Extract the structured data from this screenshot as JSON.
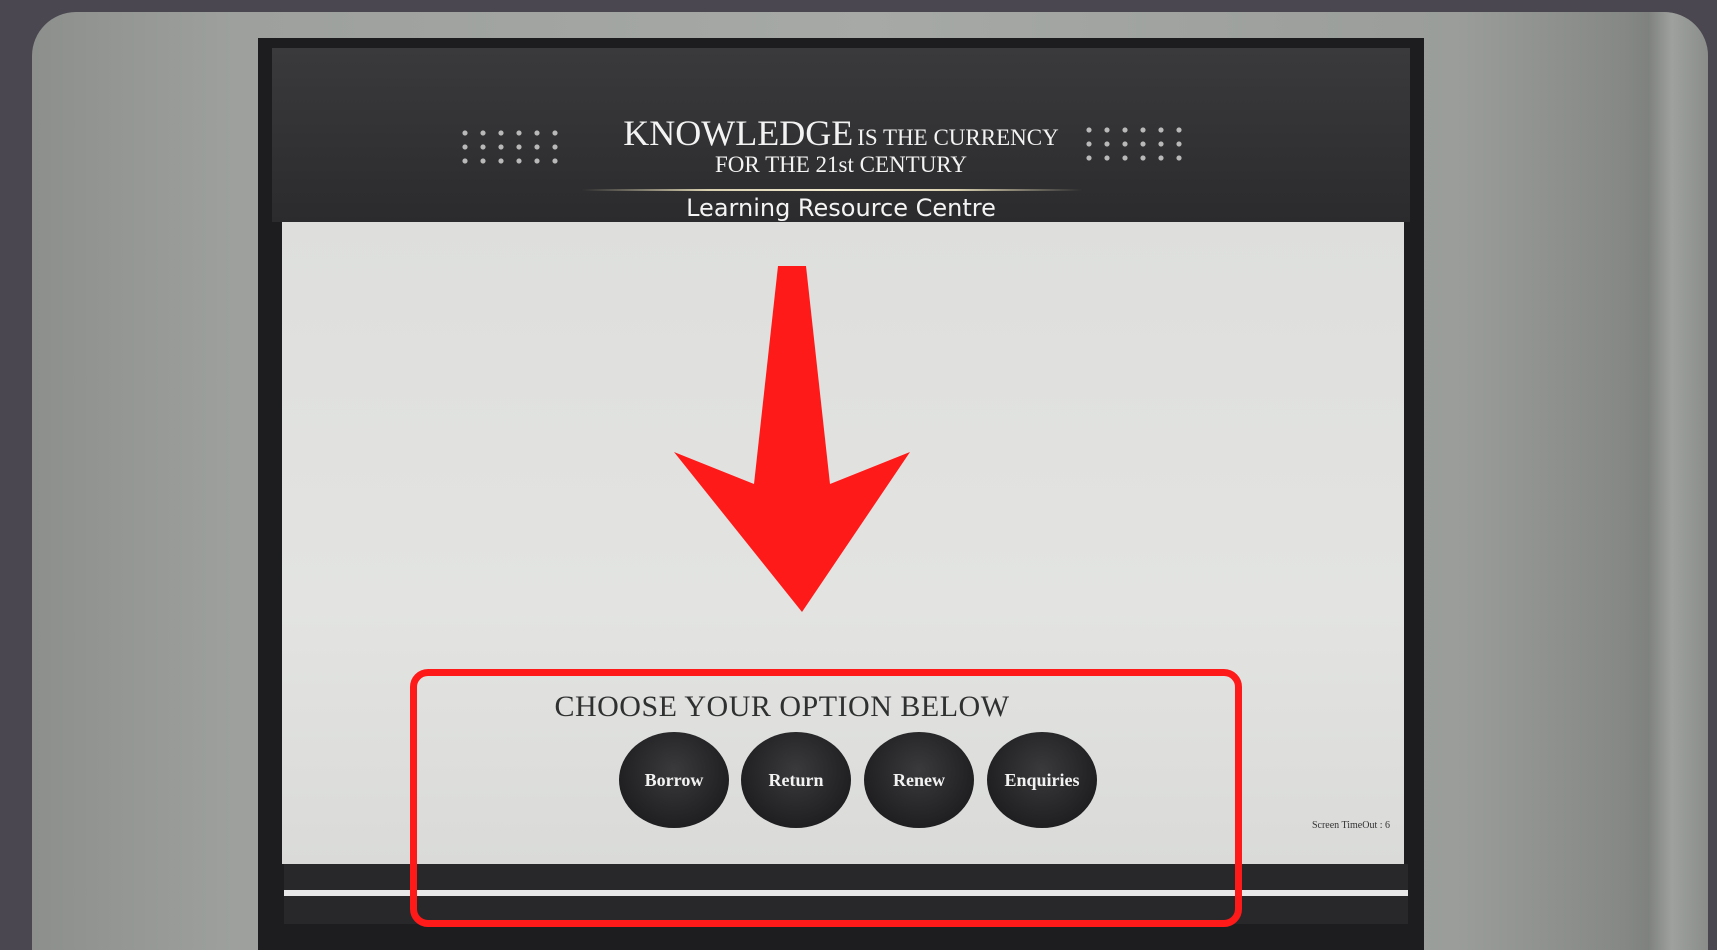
{
  "kiosk": {
    "tagline": {
      "word_big": "KNOWLEDGE",
      "rest_line1": "IS THE CURRENCY",
      "line2": "FOR THE 21st CENTURY"
    },
    "organization": "Learning Resource Centre",
    "prompt": "CHOOSE YOUR OPTION BELOW",
    "options": [
      {
        "label": "Borrow"
      },
      {
        "label": "Return"
      },
      {
        "label": "Renew"
      },
      {
        "label": "Enquiries"
      }
    ],
    "screen_timeout": "Screen TimeOut : 6"
  },
  "annotation": {
    "arrow_color": "#ff1a1a",
    "box_color": "#ff1a1a",
    "arrow_icon": "down-arrow-icon"
  },
  "colors": {
    "header_bg": "#2b2b2d",
    "screen_bg": "#e0e1df",
    "button_bg": "#1e1e20"
  }
}
